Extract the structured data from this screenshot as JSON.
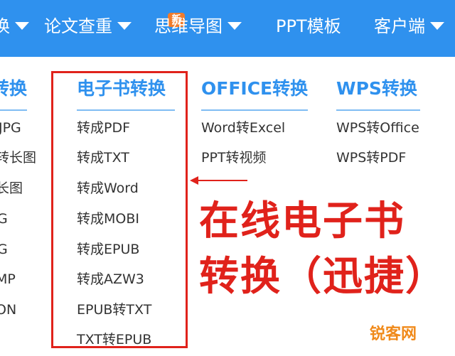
{
  "nav": {
    "items": [
      {
        "label": "换"
      },
      {
        "label": "论文查重"
      },
      {
        "label": "思维导图"
      },
      {
        "label": "PPT模板"
      },
      {
        "label": "客户端"
      }
    ],
    "new_badge": "新"
  },
  "columns": {
    "partial": {
      "title": "转换",
      "links": [
        "JPG",
        "转长图",
        "长图",
        "G",
        "G",
        "MP",
        "ON"
      ]
    },
    "ebook": {
      "title": "电子书转换",
      "links": [
        "转成PDF",
        "转成TXT",
        "转成Word",
        "转成MOBI",
        "转成EPUB",
        "转成AZW3",
        "EPUB转TXT",
        "TXT转EPUB"
      ]
    },
    "office": {
      "title": "OFFICE转换",
      "links": [
        "Word转Excel",
        "PPT转视频"
      ]
    },
    "wps": {
      "title": "WPS转换",
      "links": [
        "WPS转Office",
        "WPS转PDF"
      ]
    }
  },
  "annotation": {
    "line1": "在线电子书",
    "line2": "转换（迅捷）"
  },
  "watermark": "锐客网",
  "colors": {
    "nav_bg": "#2f91ee",
    "accent_blue": "#2f91ee",
    "annotation_red": "#e0221b",
    "badge_orange": "#f27c2b"
  }
}
